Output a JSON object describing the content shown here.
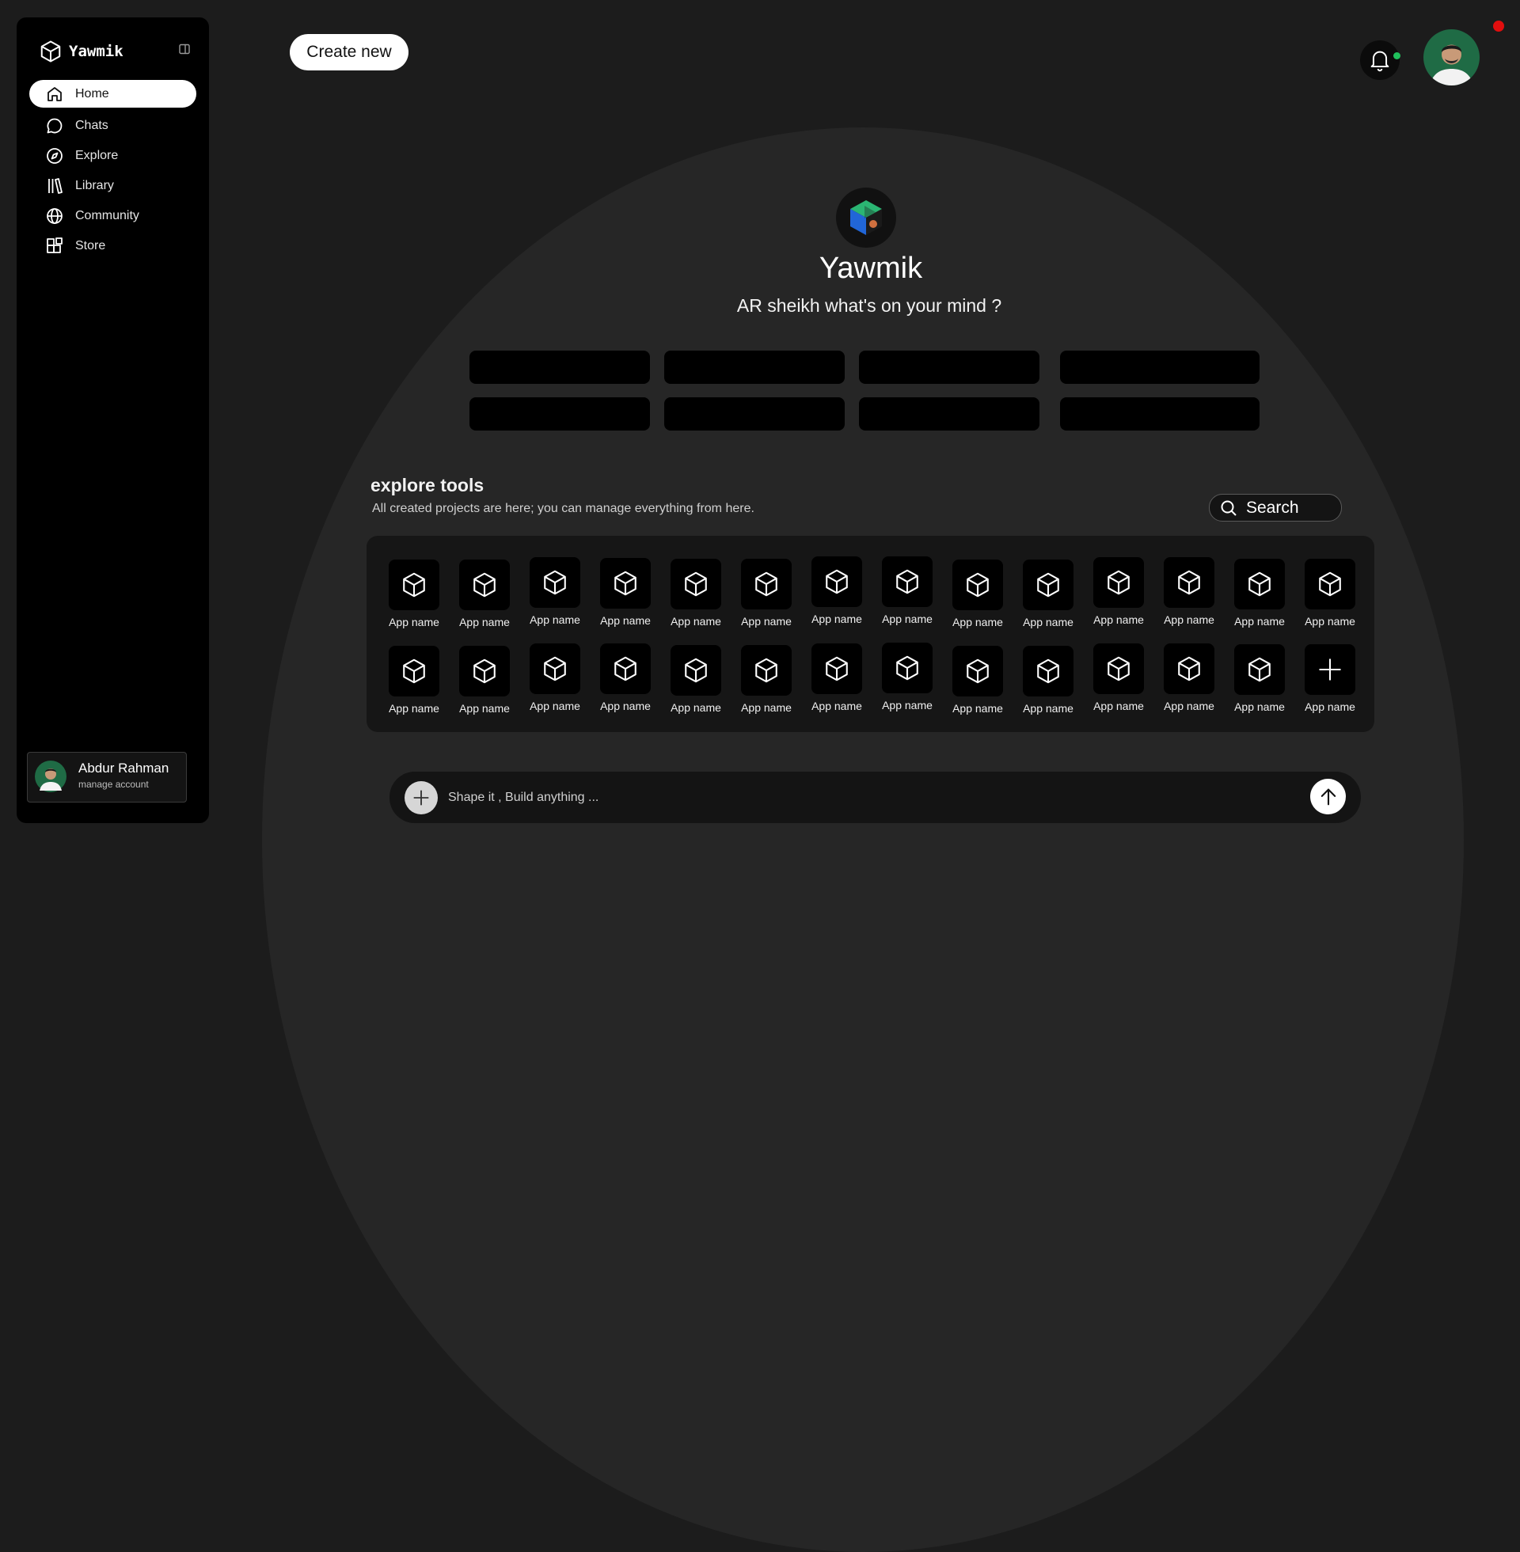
{
  "sidebar": {
    "brand": "Yawmik",
    "items": [
      {
        "label": "Home",
        "icon": "home-icon",
        "active": true
      },
      {
        "label": "Chats",
        "icon": "chat-icon"
      },
      {
        "label": "Explore",
        "icon": "compass-icon"
      },
      {
        "label": "Library",
        "icon": "library-icon"
      },
      {
        "label": "Community",
        "icon": "globe-icon"
      },
      {
        "label": "Store",
        "icon": "store-icon"
      }
    ],
    "account": {
      "name": "Abdur Rahman",
      "subtitle": "manage account"
    }
  },
  "header": {
    "create_label": "Create new"
  },
  "hero": {
    "title": "Yawmik",
    "subtitle": "AR sheikh what's on your mind ?"
  },
  "explore": {
    "title": "explore tools",
    "subtitle": "All created projects are here; you can manage everything from here.",
    "search_label": "Search",
    "tiles_row1": [
      "App name",
      "App name",
      "App name",
      "App name",
      "App name",
      "App name",
      "App name",
      "App name",
      "App name",
      "App name",
      "App name",
      "App name",
      "App name",
      "App name"
    ],
    "tiles_row2": [
      "App name",
      "App name",
      "App name",
      "App name",
      "App name",
      "App name",
      "App name",
      "App name",
      "App name",
      "App name",
      "App name",
      "App name",
      "App name",
      "App name"
    ],
    "last_tile_icon": "plus-icon"
  },
  "prompt": {
    "placeholder": "Shape it , Build anything ..."
  },
  "colors": {
    "accent_green": "#20c05c",
    "record_red": "#e10e0e",
    "panel": "#161616",
    "background": "#1c1c1c"
  }
}
